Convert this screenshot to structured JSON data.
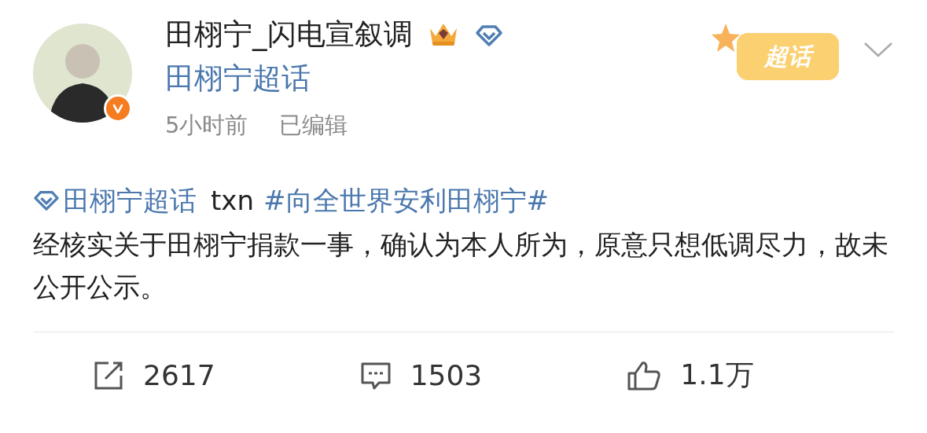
{
  "author": {
    "name": "田栩宁_闪电宣叙调",
    "verified": true,
    "supertopic": "田栩宁超话"
  },
  "time": "5小时前",
  "edited": "已编辑",
  "badge": "超话",
  "post": {
    "topic": "田栩宁超话",
    "text": "txn",
    "hashtag": "#向全世界安利田栩宁#",
    "body": "经核实关于田栩宁捐款一事，确认为本人所为，原意只想低调尽力，故未公开公示。"
  },
  "actions": [
    {
      "kind": "repost",
      "count": "2617"
    },
    {
      "kind": "comment",
      "count": "1503"
    },
    {
      "kind": "like",
      "count": "1.1万"
    }
  ]
}
